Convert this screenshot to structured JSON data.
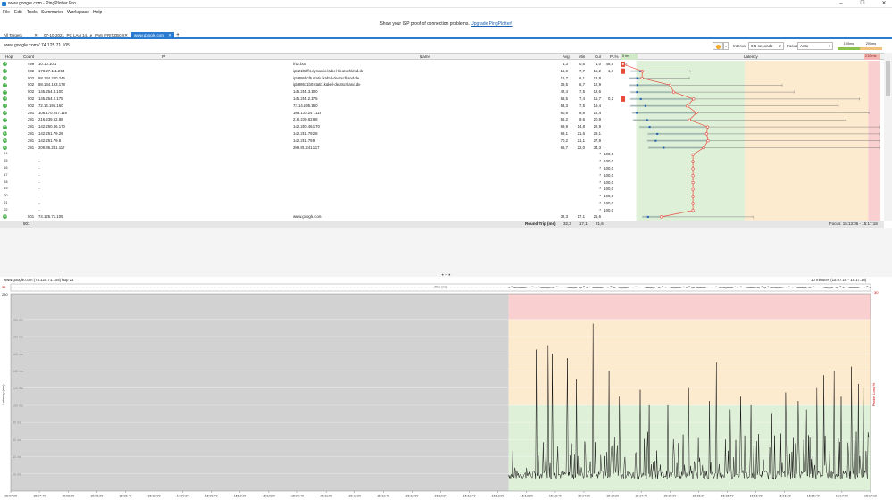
{
  "window": {
    "title": "www.google.com - PingPlotter Pro",
    "controls": [
      "–",
      "☐",
      "✕"
    ]
  },
  "menu": [
    "File",
    "Edit",
    "Tools",
    "Summaries",
    "Workspace",
    "Help"
  ],
  "banner": {
    "text": "Show your ISP proof of connection problems.",
    "link": "Upgrade PingPlotter!"
  },
  "tabs": [
    {
      "label": "All Targets",
      "active": false
    },
    {
      "label": "07-10-2021_PC LAN 14...e_IPv6_FRITZBOX",
      "active": false
    },
    {
      "label": "www.google.com",
      "active": true
    }
  ],
  "targetbar": {
    "target": "www.google.com / 74.125.71.105",
    "interval_label": "Interval",
    "interval_value": "0.5 seconds",
    "focus_label": "Focus",
    "focus_value": "Auto",
    "legend_100": "100ms",
    "legend_200": "200ms"
  },
  "columns": {
    "hop": "Hop",
    "count": "Count",
    "ip": "IP",
    "name": "Name",
    "avg": "Avg",
    "min": "Min",
    "cur": "Cur",
    "pl": "PL%",
    "latency": "Latency",
    "scale_min": "0 ms",
    "scale_max": "210 ms"
  },
  "hops": [
    {
      "hop": "1",
      "count": "499",
      "ip": "10.10.10.1",
      "name": "fritz.box",
      "avg": "1,3",
      "min": "0,5",
      "cur": "1,0",
      "pl": "48,5",
      "color": "#4caf50"
    },
    {
      "hop": "2",
      "count": "502",
      "ip": "178.27.111.254",
      "name": "ipb21b6ff4.dynamic.kabel-deutschland.de",
      "avg": "16,9",
      "min": "7,7",
      "cur": "15,2",
      "pl": "1,8",
      "color": "#4caf50"
    },
    {
      "hop": "3",
      "count": "502",
      "ip": "88.134.220.246",
      "name": "ip5886dcf6.static.kabel-deutschland.de",
      "avg": "16,7",
      "min": "6,1",
      "cur": "12,8",
      "pl": "",
      "color": "#4caf50"
    },
    {
      "hop": "4",
      "count": "502",
      "ip": "88.134.193.178",
      "name": "ip5886c1b0.static.kabel-deutschland.de",
      "avg": "39,5",
      "min": "6,7",
      "cur": "12,9",
      "pl": "",
      "color": "#4caf50"
    },
    {
      "hop": "5",
      "count": "502",
      "ip": "145.254.3.100",
      "name": "145.254.3.100",
      "avg": "42,4",
      "min": "7,5",
      "cur": "12,6",
      "pl": "",
      "color": "#4caf50"
    },
    {
      "hop": "6",
      "count": "502",
      "ip": "145.254.2.175",
      "name": "145.254.2.175",
      "avg": "58,5",
      "min": "7,4",
      "cur": "15,7",
      "pl": "0,2",
      "color": "#4caf50"
    },
    {
      "hop": "7",
      "count": "502",
      "ip": "72.14.195.160",
      "name": "72.14.195.160",
      "avg": "53,3",
      "min": "7,5",
      "cur": "19,4",
      "pl": "",
      "color": "#4caf50"
    },
    {
      "hop": "8",
      "count": "291",
      "ip": "108.170.247.119",
      "name": "108.170.247.119",
      "avg": "60,8",
      "min": "8,9",
      "cur": "12,4",
      "pl": "",
      "color": "#4caf50"
    },
    {
      "hop": "9",
      "count": "291",
      "ip": "216.239.62.88",
      "name": "216.239.62.88",
      "avg": "55,2",
      "min": "9,6",
      "cur": "20,8",
      "pl": "",
      "color": "#4caf50"
    },
    {
      "hop": "10",
      "count": "291",
      "ip": "142.250.46.170",
      "name": "142.250.46.170",
      "avg": "69,9",
      "min": "14,8",
      "cur": "22,9",
      "pl": "",
      "color": "#4caf50"
    },
    {
      "hop": "11",
      "count": "291",
      "ip": "142.251.79.28",
      "name": "142.251.79.28",
      "avg": "69,1",
      "min": "21,6",
      "cur": "29,1",
      "pl": "",
      "color": "#4caf50"
    },
    {
      "hop": "12",
      "count": "291",
      "ip": "142.251.79.8",
      "name": "142.251.79.8",
      "avg": "70,2",
      "min": "21,1",
      "cur": "27,8",
      "pl": "",
      "color": "#4caf50"
    },
    {
      "hop": "13",
      "count": "291",
      "ip": "209.85.241.117",
      "name": "209.85.241.117",
      "avg": "66,7",
      "min": "22,0",
      "cur": "34,3",
      "pl": "",
      "color": "#4caf50"
    },
    {
      "hop": "14",
      "count": "",
      "ip": "-",
      "name": "",
      "avg": "",
      "min": "",
      "cur": "*",
      "pl": "100,0",
      "color": ""
    },
    {
      "hop": "15",
      "count": "",
      "ip": "-",
      "name": "",
      "avg": "",
      "min": "",
      "cur": "*",
      "pl": "100,0",
      "color": ""
    },
    {
      "hop": "16",
      "count": "",
      "ip": "-",
      "name": "",
      "avg": "",
      "min": "",
      "cur": "*",
      "pl": "100,0",
      "color": ""
    },
    {
      "hop": "17",
      "count": "",
      "ip": "-",
      "name": "",
      "avg": "",
      "min": "",
      "cur": "*",
      "pl": "100,0",
      "color": ""
    },
    {
      "hop": "18",
      "count": "",
      "ip": "-",
      "name": "",
      "avg": "",
      "min": "",
      "cur": "*",
      "pl": "100,0",
      "color": ""
    },
    {
      "hop": "19",
      "count": "",
      "ip": "-",
      "name": "",
      "avg": "",
      "min": "",
      "cur": "*",
      "pl": "100,0",
      "color": ""
    },
    {
      "hop": "20",
      "count": "",
      "ip": "-",
      "name": "",
      "avg": "",
      "min": "",
      "cur": "*",
      "pl": "100,0",
      "color": ""
    },
    {
      "hop": "21",
      "count": "",
      "ip": "-",
      "name": "",
      "avg": "",
      "min": "",
      "cur": "*",
      "pl": "100,0",
      "color": ""
    },
    {
      "hop": "22",
      "count": "",
      "ip": "-",
      "name": "",
      "avg": "",
      "min": "",
      "cur": "*",
      "pl": "100,0",
      "color": ""
    },
    {
      "hop": "23",
      "count": "501",
      "ip": "74.125.71.105",
      "name": "www.google.com",
      "avg": "32,3",
      "min": "17,1",
      "cur": "21,6",
      "pl": "",
      "color": "#4caf50"
    }
  ],
  "round_trip": {
    "count": "501",
    "label": "Round Trip (ms)",
    "avg": "32,3",
    "min": "17,1",
    "cur": "21,6",
    "focus": "Focus: 15:13:06 - 15:17:18"
  },
  "graph": {
    "title": "www.google.com (74.125.71.105) hop 23",
    "range": "10 minutes (15:07:18 - 15:17:18)",
    "jitter_label": "Jitter (ms)",
    "jitter_left": "35",
    "jitter_right": "30",
    "ymax": "230",
    "ylabel_left": "Latency (ms)",
    "ylabel_right": "Packet Loss %",
    "ylabels": [
      "200 ms",
      "180 ms",
      "160 ms",
      "140 ms",
      "120 ms",
      "100 ms",
      "80 ms",
      "60 ms",
      "40 ms",
      "20 ms"
    ],
    "xlabels": [
      "15:07:20",
      "15:07:40",
      "15:08:00",
      "15:08:20",
      "15:08:40",
      "15:09:00",
      "15:09:20",
      "15:09:40",
      "15:10:00",
      "15:10:20",
      "15:10:40",
      "15:11:00",
      "15:11:20",
      "15:11:40",
      "15:12:00",
      "15:12:20",
      "15:12:40",
      "15:13:00",
      "15:13:20",
      "15:13:40",
      "15:14:00",
      "15:14:20",
      "15:14:40",
      "15:15:00",
      "15:15:20",
      "15:15:40",
      "15:16:00",
      "15:16:20",
      "15:16:40",
      "15:17:00",
      "15:17:18"
    ]
  },
  "colors": {
    "accent": "#2b7bd0",
    "zone_good": "#dff0d8",
    "zone_warn": "#fdebd0",
    "zone_bad": "#f9d0cf",
    "no_data": "#d2d2d2",
    "latency_line": "#e84c3d"
  }
}
